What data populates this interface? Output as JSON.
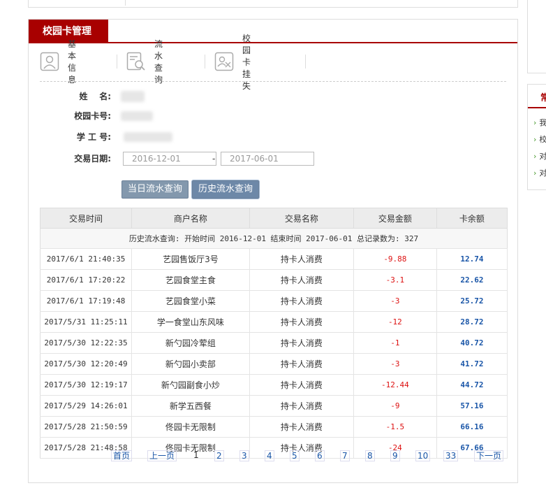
{
  "panel": {
    "title": "校园卡管理"
  },
  "tabs": [
    {
      "label": "基本信息",
      "icon": "user-icon"
    },
    {
      "label": "流水查询",
      "icon": "search-document-icon"
    },
    {
      "label": "校园卡挂失",
      "icon": "card-report-loss-icon"
    }
  ],
  "form": {
    "name_label": "姓    名:",
    "card_label": "校园卡号:",
    "id_label": "学 工 号:",
    "date_label": "交易日期:",
    "date_from": "2016-12-01",
    "date_sep": "-",
    "date_to": "2017-06-01"
  },
  "buttons": {
    "today": "当日流水查询",
    "history": "历史流水查询"
  },
  "table": {
    "headers": [
      "交易时间",
      "商户名称",
      "交易名称",
      "交易金额",
      "卡余额"
    ],
    "summary": "历史流水查询: 开始时间 2016-12-01 结束时间 2017-06-01 总记录数为: 327",
    "rows": [
      {
        "time": "2017/6/1 21:40:35",
        "merchant": "艺园售饭厅3号",
        "type": "持卡人消费",
        "amount": "-9.88",
        "balance": "12.74"
      },
      {
        "time": "2017/6/1 17:20:22",
        "merchant": "艺园食堂主食",
        "type": "持卡人消费",
        "amount": "-3.1",
        "balance": "22.62"
      },
      {
        "time": "2017/6/1 17:19:48",
        "merchant": "艺园食堂小菜",
        "type": "持卡人消费",
        "amount": "-3",
        "balance": "25.72"
      },
      {
        "time": "2017/5/31 11:25:11",
        "merchant": "学一食堂山东风味",
        "type": "持卡人消费",
        "amount": "-12",
        "balance": "28.72"
      },
      {
        "time": "2017/5/30 12:22:35",
        "merchant": "新勺园冷荤组",
        "type": "持卡人消费",
        "amount": "-1",
        "balance": "40.72"
      },
      {
        "time": "2017/5/30 12:20:49",
        "merchant": "新勺园小卖部",
        "type": "持卡人消费",
        "amount": "-3",
        "balance": "41.72"
      },
      {
        "time": "2017/5/30 12:19:17",
        "merchant": "新勺园副食小炒",
        "type": "持卡人消费",
        "amount": "-12.44",
        "balance": "44.72"
      },
      {
        "time": "2017/5/29 14:26:01",
        "merchant": "新学五西餐",
        "type": "持卡人消费",
        "amount": "-9",
        "balance": "57.16"
      },
      {
        "time": "2017/5/28 21:50:59",
        "merchant": "佟园卡无限制",
        "type": "持卡人消费",
        "amount": "-1.5",
        "balance": "66.16"
      },
      {
        "time": "2017/5/28 21:48:58",
        "merchant": "佟园卡无限制",
        "type": "持卡人消费",
        "amount": "-24",
        "balance": "67.66"
      }
    ]
  },
  "pager": {
    "first": "首页",
    "prev": "上一页",
    "current": "1",
    "pages": [
      "2",
      "3",
      "4",
      "5",
      "6",
      "7",
      "8",
      "9",
      "10",
      "33"
    ],
    "next": "下一页"
  },
  "colors": {
    "brand": "#a80000",
    "amount": "#dd1111",
    "balance": "#1a56a8",
    "button": "#8398ad"
  }
}
